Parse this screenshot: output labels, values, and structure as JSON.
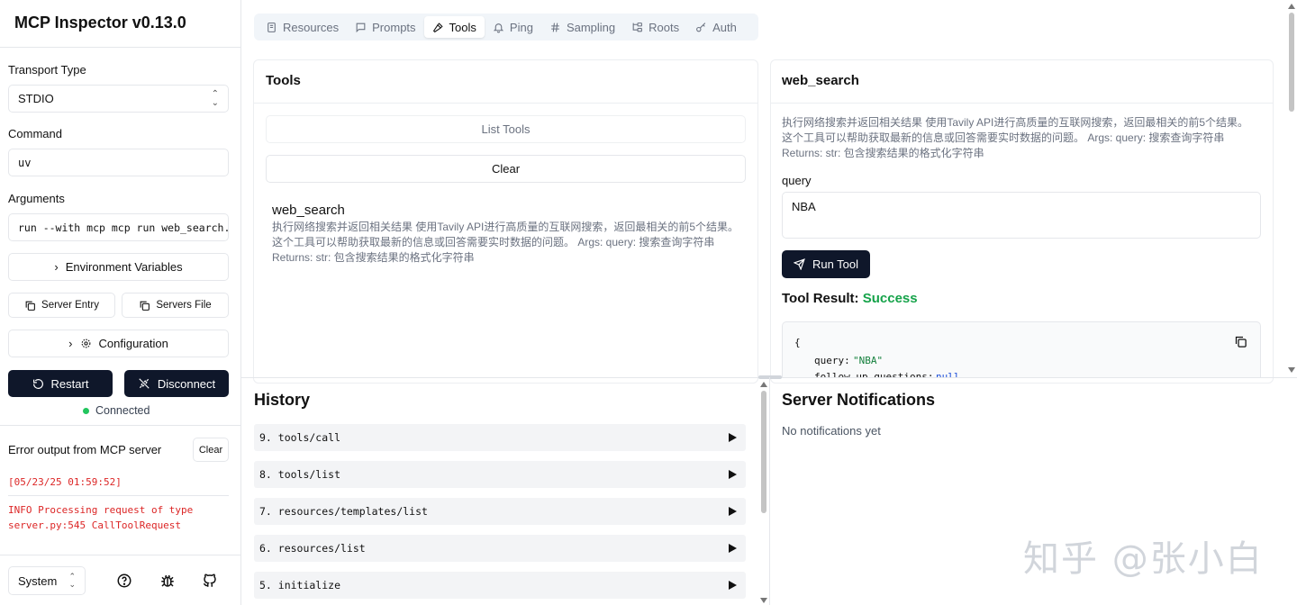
{
  "app": {
    "title": "MCP Inspector v0.13.0"
  },
  "sidebar": {
    "transport_label": "Transport Type",
    "transport_value": "STDIO",
    "command_label": "Command",
    "command_value": "uv",
    "arguments_label": "Arguments",
    "arguments_value": "run --with mcp mcp run web_search.py",
    "env_label": "Environment Variables",
    "server_entry_label": "Server Entry",
    "servers_file_label": "Servers File",
    "config_label": "Configuration",
    "restart_label": "Restart",
    "disconnect_label": "Disconnect",
    "status": "Connected",
    "status_color": "#22c55e",
    "error_title": "Error output from MCP server",
    "error_clear": "Clear",
    "logs": [
      "[05/23/25 01:59:52]",
      "INFO Processing request of type",
      "server.py:545 CallToolRequest"
    ],
    "theme_value": "System"
  },
  "tabs": [
    {
      "label": "Resources",
      "icon": "file-icon"
    },
    {
      "label": "Prompts",
      "icon": "message-icon"
    },
    {
      "label": "Tools",
      "icon": "hammer-icon",
      "active": true
    },
    {
      "label": "Ping",
      "icon": "bell-icon"
    },
    {
      "label": "Sampling",
      "icon": "hash-icon"
    },
    {
      "label": "Roots",
      "icon": "folder-tree-icon"
    },
    {
      "label": "Auth",
      "icon": "key-icon"
    }
  ],
  "tools_panel": {
    "title": "Tools",
    "list_button": "List Tools",
    "clear_button": "Clear",
    "tool_name": "web_search",
    "tool_desc": [
      "执行网络搜索并返回相关结果 使用Tavily API进行高质量的互联网搜索，返回最相关的前5个结果。",
      "这个工具可以帮助获取最新的信息或回答需要实时数据的问题。 Args: query: 搜索查询字符串",
      "Returns: str: 包含搜索结果的格式化字符串"
    ]
  },
  "detail_panel": {
    "title": "web_search",
    "desc": [
      "执行网络搜索并返回相关结果 使用Tavily API进行高质量的互联网搜索，返回最相关的前5个结果。",
      "这个工具可以帮助获取最新的信息或回答需要实时数据的问题。 Args: query: 搜索查询字符串",
      "Returns: str: 包含搜索结果的格式化字符串"
    ],
    "param_label": "query",
    "param_value": "NBA",
    "run_button": "Run Tool",
    "result_label": "Tool Result:",
    "result_status": "Success",
    "result_status_color": "#16a34a",
    "result_lines": [
      "{",
      "query:",
      "\"NBA\"",
      "follow_up_questions:",
      "null"
    ]
  },
  "history": {
    "title": "History",
    "items": [
      "9. tools/call",
      "8. tools/list",
      "7. resources/templates/list",
      "6. resources/list",
      "5. initialize"
    ]
  },
  "notifications": {
    "title": "Server Notifications",
    "empty": "No notifications yet"
  },
  "watermark": "知乎 @张小白"
}
